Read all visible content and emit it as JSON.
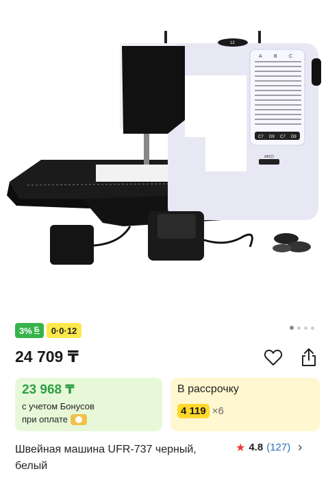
{
  "gallery": {
    "image_alt": "sewing-machine",
    "machine_labels": {
      "cols": [
        "A",
        "B",
        "C"
      ],
      "special": [
        "C7",
        "D9",
        "C7",
        "D9"
      ],
      "mode": "ABCD",
      "dial": "12"
    },
    "carousel_dots": 4,
    "active_dot": 0
  },
  "badges": {
    "bonus": "3%",
    "bonus_mark": "Б",
    "installment": "0·0·12"
  },
  "price": {
    "value": "24 709 ₸"
  },
  "bonus_card": {
    "amount": "23 968 ₸",
    "line1": "с учетом Бонусов",
    "line2": "при оплате"
  },
  "installment_card": {
    "title": "В рассрочку",
    "amount": "4 119",
    "multiplier": "×6"
  },
  "product": {
    "name": "Швейная машина UFR-737 черный, белый"
  },
  "rating": {
    "value": "4.8",
    "count": "(127)"
  },
  "colors": {
    "bonus_green": "#37b34a",
    "installment_yellow": "#fde84a",
    "price_text": "#1a1a1a"
  }
}
